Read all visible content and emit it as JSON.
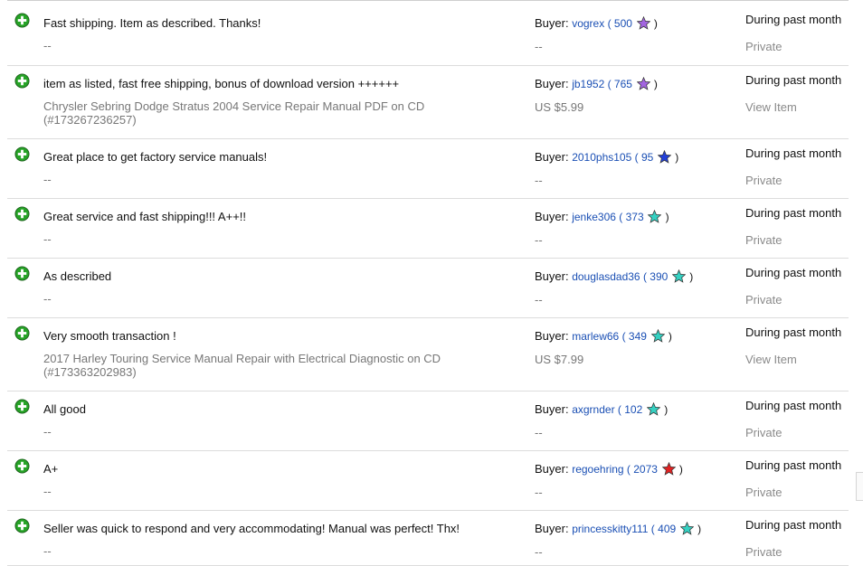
{
  "feedback": [
    {
      "comment": "Fast shipping. Item as described. Thanks!",
      "item": "--",
      "buyer_prefix": "Buyer:",
      "buyer": "vogrex",
      "score": "500",
      "star": "purple",
      "price": "--",
      "when": "During past month",
      "detail": "Private"
    },
    {
      "comment": "item as listed, fast free shipping, bonus of download version ++++++",
      "item": "Chrysler Sebring Dodge Stratus 2004 Service Repair Manual PDF on CD (#173267236257)",
      "buyer_prefix": "Buyer:",
      "buyer": "jb1952",
      "score": "765",
      "star": "purple",
      "price": "US $5.99",
      "when": "During past month",
      "detail": "View Item"
    },
    {
      "comment": "Great place to get factory service manuals!",
      "item": "--",
      "buyer_prefix": "Buyer:",
      "buyer": "2010phs105",
      "score": "95",
      "star": "blue",
      "price": "--",
      "when": "During past month",
      "detail": "Private"
    },
    {
      "comment": "Great service and fast shipping!!! A++!!",
      "item": "--",
      "buyer_prefix": "Buyer:",
      "buyer": "jenke306",
      "score": "373",
      "star": "turquoise",
      "price": "--",
      "when": "During past month",
      "detail": "Private"
    },
    {
      "comment": "As described",
      "item": "--",
      "buyer_prefix": "Buyer:",
      "buyer": "douglasdad36",
      "score": "390",
      "star": "turquoise",
      "price": "--",
      "when": "During past month",
      "detail": "Private"
    },
    {
      "comment": "Very smooth transaction !",
      "item": "2017 Harley Touring Service Manual Repair with Electrical Diagnostic on CD (#173363202983)",
      "buyer_prefix": "Buyer:",
      "buyer": "marlew66",
      "score": "349",
      "star": "turquoise",
      "price": "US $7.99",
      "when": "During past month",
      "detail": "View Item"
    },
    {
      "comment": "All good",
      "item": "--",
      "buyer_prefix": "Buyer:",
      "buyer": "axgrnder",
      "score": "102",
      "star": "turquoise",
      "price": "--",
      "when": "During past month",
      "detail": "Private"
    },
    {
      "comment": "A+",
      "item": "--",
      "buyer_prefix": "Buyer:",
      "buyer": "regoehring",
      "score": "2073",
      "star": "red",
      "price": "--",
      "when": "During past month",
      "detail": "Private"
    },
    {
      "comment": "Seller was quick to respond and very accommodating! Manual was perfect! Thx!",
      "item": "--",
      "buyer_prefix": "Buyer:",
      "buyer": "princesskitty111",
      "score": "409",
      "star": "turquoise",
      "price": "--",
      "when": "During past month",
      "detail": "Private"
    }
  ],
  "star_colors": {
    "purple": "#a365e0",
    "blue": "#2340d8",
    "turquoise": "#35d1c2",
    "red": "#e32222"
  },
  "plus_color": "#26a326"
}
